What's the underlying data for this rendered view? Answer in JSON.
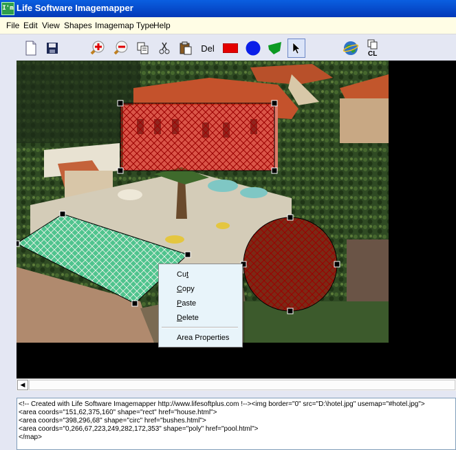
{
  "titlebar": {
    "icon_text": "I'm",
    "title": "Life Software Imagemapper"
  },
  "menu": [
    "File",
    "Edit",
    "View",
    "Shapes",
    "Imagemap Type",
    "Help"
  ],
  "toolbar": {
    "buttons": [
      "new-file",
      "save",
      "zoom-in",
      "zoom-out",
      "copy",
      "cut",
      "paste",
      "delete",
      "rectangle-shape",
      "circle-shape",
      "polygon-shape",
      "select-pointer",
      "preview-browser",
      "clear"
    ],
    "del_label": "Del",
    "cl_label": "CL",
    "colors": {
      "rect": "#e40000",
      "circle": "#0a1ee8",
      "poly": "#0c9a22"
    }
  },
  "context_menu": {
    "items": [
      {
        "label": "Cut",
        "accel": "t"
      },
      {
        "label": "Copy",
        "accel": "C"
      },
      {
        "label": "Paste",
        "accel": "P"
      },
      {
        "label": "Delete",
        "accel": "D"
      }
    ],
    "area_properties": "Area Properties"
  },
  "code": {
    "lines": [
      "<!-- Created with Life Software Imagemapper http://www.lifesoftplus.com !--><img border=\"0\" src=\"D:\\hotel.jpg\" usemap=\"#hotel.jpg\">",
      "<area coords=\"151,62,375,160\"  shape=\"rect\" href=\"house.html\">",
      "<area coords=\"398,296,68\" shape=\"circ\" href=\"bushes.html\">",
      "<area coords=\"0,266,67,223,249,282,172,353\" shape=\"poly\" href=\"pool.html\">",
      "</map>"
    ]
  }
}
